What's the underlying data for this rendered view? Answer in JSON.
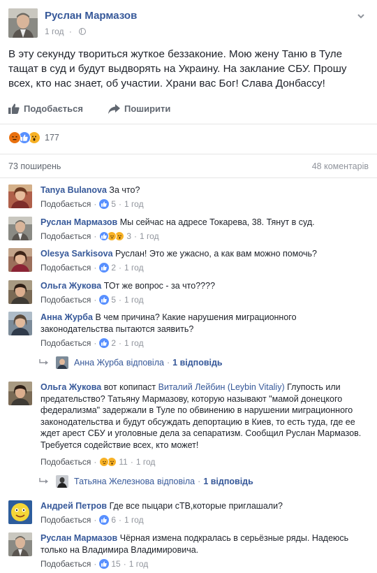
{
  "post": {
    "author": "Руслан Мармазов",
    "time": "1 год",
    "text": "В эту секунду твориться жуткое беззаконие. Мою жену Таню в Туле тащат в суд и будут выдворять на Украину. На заклание СБУ. Прошу всех, кто нас знает, об участии. Храни вас Бог! Слава Донбассу!",
    "like_label": "Подобається",
    "share_label": "Поширити",
    "reactions_count": "177",
    "shares_label": "73 поширень",
    "comments_label": "48 коментарів"
  },
  "comments": [
    {
      "author": "Tanya Bulanova",
      "text": "За что?",
      "like_label": "Подобається",
      "likes": "5",
      "time": "1 год"
    },
    {
      "author": "Руслан Мармазов",
      "text": "Мы сейчас на адресе Токарева, 38. Тянут в суд.",
      "like_label": "Подобається",
      "likes": "3",
      "time": "1 год"
    },
    {
      "author": "Olesya Sarkisova",
      "text": "Руслан! Это же ужасно, а как вам можно помочь?",
      "like_label": "Подобається",
      "likes": "2",
      "time": "1 год"
    },
    {
      "author": "Ольга Жукова",
      "text": "ТОт же вопрос - за что????",
      "like_label": "Подобається",
      "likes": "5",
      "time": "1 год"
    },
    {
      "author": "Анна Журба",
      "text": "В чем причина? Какие нарушения миграционного законодательства пытаются заявить?",
      "like_label": "Подобається",
      "likes": "2",
      "time": "1 год",
      "reply_author": "Анна Журба",
      "reply_verb": "відповіла",
      "reply_count": "1 відповідь"
    },
    {
      "author": "Ольга Жукова",
      "text_prefix": "вот копипаст",
      "mentioned": "Виталий Лейбин (Leybin Vitaliy)",
      "text": "Глупость или предательство? Татьяну Мармазову, которую называют \"мамой донецкого федерализма\" задержали в Туле по обвинению в нарушении миграционного законодательства и будут обсуждать депортацию в Киев, то есть туда, где ее ждет арест СБУ и уголовные дела за сепаратизм. Сообщил Руслан Мармазов. Требуется содействие всех, кто может!",
      "like_label": "Подобається",
      "likes": "11",
      "time": "1 год",
      "reply_author": "Татьяна Железнова",
      "reply_verb": "відповіла",
      "reply_count": "1 відповідь"
    },
    {
      "author": "Андрей Петров",
      "text": "Где все пыцари сТВ,которые приглашали?",
      "like_label": "Подобається",
      "likes": "6",
      "time": "1 год"
    },
    {
      "author": "Руслан Мармазов",
      "text": "Чёрная измена подкралась в серьёзные ряды. Надеюсь только на Владимира Владимировича.",
      "like_label": "Подобається",
      "likes": "15",
      "time": "1 год"
    }
  ]
}
